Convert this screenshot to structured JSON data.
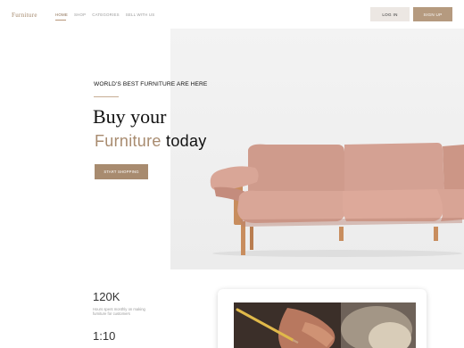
{
  "header": {
    "logo": "Furniture",
    "nav": [
      "Home",
      "Shop",
      "Categories",
      "Sell with us"
    ],
    "login_label": "Log in",
    "signup_label": "Sign up"
  },
  "hero": {
    "eyebrow": "World's best furniture are here",
    "title_line1": "Buy your",
    "title_accent": "Furniture",
    "title_rest": " today",
    "cta_label": "Start shopping"
  },
  "stats": [
    {
      "value": "120K",
      "description": "Hours spent monthly on making furniture for customers"
    },
    {
      "value": "1:10",
      "description": ""
    }
  ],
  "colors": {
    "accent": "#a88b6f",
    "signup_button": "#b59a7f",
    "login_button": "#ece7e3",
    "sofa": "#d4a193",
    "wood": "#c88d5e"
  }
}
